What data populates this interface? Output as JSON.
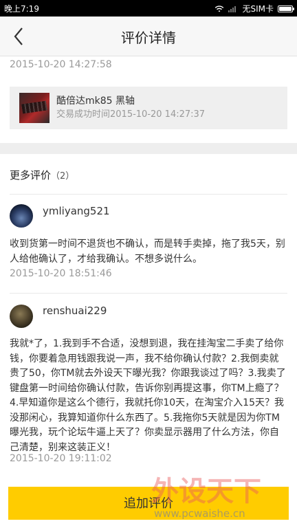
{
  "status_bar": {
    "time": "晚上7:19",
    "carrier": "无SIM卡"
  },
  "header": {
    "title": "评价详情"
  },
  "top_review": {
    "date": "2015-10-20 14:27:58"
  },
  "product": {
    "name": "酷倍达mk85 黑轴",
    "trade_time": "交易成功时间2015-10-20 14:27:37"
  },
  "more_reviews": {
    "title": "更多评价",
    "count": "（2）",
    "items": [
      {
        "user": "ymliyang521",
        "text": "收到货第一时间不退货也不确认，而是转手卖掉，拖了我5天，别人给他确认了，才给我确认。不想多说什么。",
        "date": "2015-10-20 18:51:46"
      },
      {
        "user": "renshuai229",
        "text": "我就*了，1.我到手不合适，没想到退，我在挂淘宝二手卖了给你钱，你要着急用钱跟我说一声，我不给你确认付款？2.我倒卖就贵了50，你TM就去外设天下曝光我？你跟我谈过了吗？3.我卖了键盘第一时间给你确认付款，告诉你别再提这事，你TM上瘾了？4.早知道你是这么个德行，我就托你10天，在淘宝介入15天？我没那闲心，我算知道你什么东西了。5.我拖你5天就是因为你TM曝光我，玩个论坛牛逼上天了？你卖显示器用了什么方法，你自己清楚，别来这装正义！",
        "date": "2015-10-20 19:11:02"
      }
    ]
  },
  "footer": {
    "add_review_label": "追加评价"
  },
  "watermark": {
    "brand": "外设天下",
    "url": "www.pcwaishe.cn"
  },
  "colors": {
    "accent": "#ffcc00",
    "secondary_text": "#999999"
  }
}
